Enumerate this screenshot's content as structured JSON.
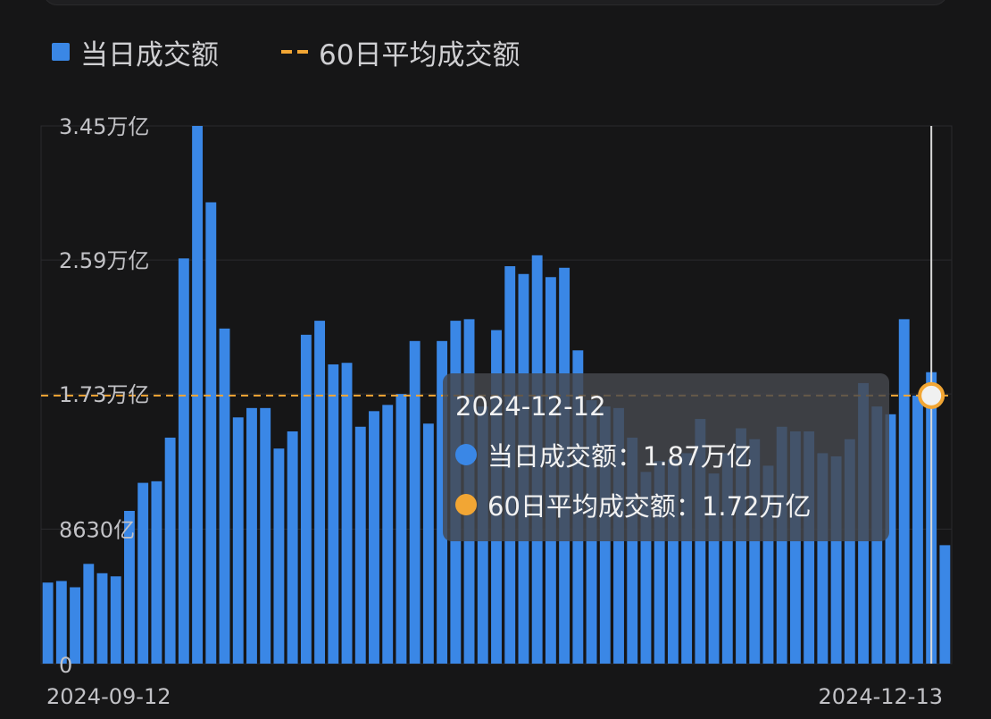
{
  "legend": {
    "bar_label": "当日成交额",
    "line_label": "60日平均成交额"
  },
  "tooltip": {
    "date": "2024-12-12",
    "bar_row": "当日成交额：1.87万亿",
    "line_row": "60日平均成交额：1.72万亿"
  },
  "colors": {
    "bar": "#3a87e6",
    "avg_line": "#f2a634",
    "background": "#161617",
    "cursor_line": "#d8d8d8"
  },
  "chart_data": {
    "type": "bar",
    "x_start_label": "2024-09-12",
    "x_end_label": "2024-12-13",
    "y_tick_labels": [
      "0",
      "8630亿",
      "1.73万亿",
      "2.59万亿",
      "3.45万亿"
    ],
    "y_tick_values": [
      0,
      0.863,
      1.73,
      2.59,
      3.45
    ],
    "ylim": [
      0,
      3.45
    ],
    "y_unit": "万亿",
    "grid": true,
    "series": [
      {
        "name": "当日成交额",
        "values": [
          0.52,
          0.53,
          0.49,
          0.64,
          0.58,
          0.56,
          0.98,
          1.16,
          1.17,
          1.45,
          2.6,
          3.45,
          2.96,
          2.15,
          1.58,
          1.64,
          1.64,
          1.38,
          1.49,
          2.11,
          2.2,
          1.92,
          1.93,
          1.52,
          1.62,
          1.66,
          1.73,
          2.07,
          1.54,
          2.07,
          2.2,
          2.21,
          1.65,
          2.14,
          2.55,
          2.5,
          2.62,
          2.48,
          2.54,
          2.01,
          1.69,
          1.65,
          1.64,
          1.45,
          1.23,
          1.3,
          1.31,
          1.35,
          1.57,
          1.22,
          1.35,
          1.51,
          1.44,
          1.27,
          1.52,
          1.49,
          1.49,
          1.35,
          1.33,
          1.44,
          1.8,
          1.65,
          1.6,
          2.21,
          1.72,
          1.87,
          0.76
        ]
      },
      {
        "name": "60日平均成交额",
        "type": "line",
        "values": [
          1.72
        ]
      }
    ],
    "selected_index": 65
  }
}
